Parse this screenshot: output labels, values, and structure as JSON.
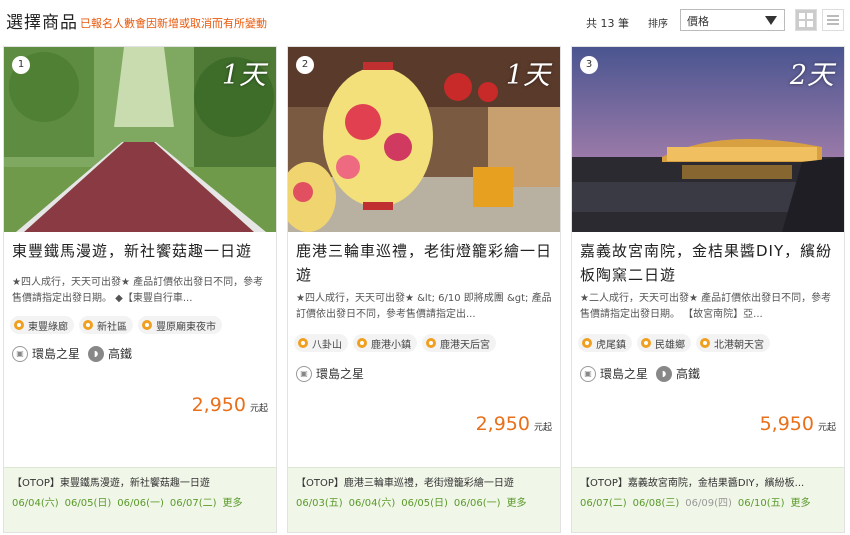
{
  "header": {
    "title": "選擇商品",
    "notice": "已報名人數會因新增或取消而有所變動",
    "count": "共 13 筆",
    "sort_label": "排序",
    "sort_value": "價格"
  },
  "cards": [
    {
      "index": "1",
      "days": "1天",
      "name": "東豐鐵馬漫遊，新社饗菇趣一日遊",
      "desc": "★四人成行，天天可出發★ 產品訂價依出發日不同，參考售價請指定出發日期。 ◆【東豐自行車...",
      "tags": [
        "東豐綠廊",
        "新社區",
        "豐原廟東夜市"
      ],
      "transport": [
        "環島之星",
        "高鐵"
      ],
      "price": "2,950",
      "price_unit": "元起",
      "otop": "【OTOP】東豐鐵馬漫遊，新社饗菇趣一日遊",
      "dates": [
        "06/04(六)",
        "06/05(日)",
        "06/06(一)",
        "06/07(二)"
      ],
      "more": "更多"
    },
    {
      "index": "2",
      "days": "1天",
      "name": "鹿港三輪車巡禮，老街燈籠彩繪一日遊",
      "desc": "★四人成行，天天可出發★ &lt; 6/10 即將成團 &gt; 產品訂價依出發日不同，參考售價請指定出...",
      "tags": [
        "八卦山",
        "鹿港小鎮",
        "鹿港天后宮"
      ],
      "transport": [
        "環島之星"
      ],
      "price": "2,950",
      "price_unit": "元起",
      "otop": "【OTOP】鹿港三輪車巡禮，老街燈籠彩繪一日遊",
      "dates": [
        "06/03(五)",
        "06/04(六)",
        "06/05(日)",
        "06/06(一)"
      ],
      "more": "更多"
    },
    {
      "index": "3",
      "days": "2天",
      "name": "嘉義故宮南院，金桔果醬DIY，繽紛板陶窯二日遊",
      "desc": "★二人成行，天天可出發★ 產品訂價依出發日不同，參考售價請指定出發日期。 【故宮南院】亞...",
      "tags": [
        "虎尾鎮",
        "民雄鄉",
        "北港朝天宮"
      ],
      "transport": [
        "環島之星",
        "高鐵"
      ],
      "price": "5,950",
      "price_unit": "元起",
      "otop": "【OTOP】嘉義故宮南院，金桔果醬DIY，繽紛板...",
      "dates": [
        "06/07(二)",
        "06/08(三)",
        "06/09(四)",
        "06/10(五)"
      ],
      "more": "更多"
    }
  ]
}
